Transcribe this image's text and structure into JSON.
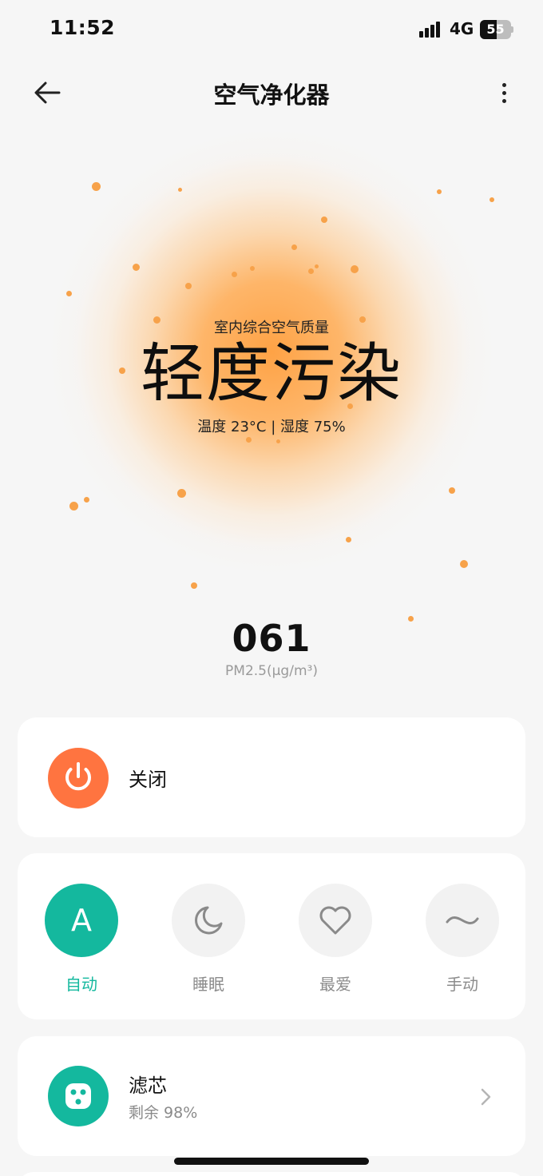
{
  "status_bar": {
    "time": "11:52",
    "network": "4G",
    "battery_level": "55",
    "battery_fraction": 0.55
  },
  "header": {
    "title": "空气净化器",
    "back_icon": "arrow-left-icon",
    "more_icon": "more-vertical-icon"
  },
  "air_quality": {
    "caption": "室内综合空气质量",
    "level": "轻度污染",
    "climate": "温度 23°C | 湿度 75%",
    "pm_value": "061",
    "pm_unit": "PM2.5(μg/m³)",
    "accent": "#f7a24a"
  },
  "power": {
    "label": "关闭",
    "icon": "power-icon",
    "color": "#ff7440"
  },
  "modes": [
    {
      "key": "auto",
      "label": "自动",
      "glyph": "A",
      "icon": "auto-letter-icon",
      "active": true
    },
    {
      "key": "sleep",
      "label": "睡眠",
      "icon": "moon-icon",
      "active": false
    },
    {
      "key": "favorite",
      "label": "最爱",
      "icon": "heart-icon",
      "active": false
    },
    {
      "key": "manual",
      "label": "手动",
      "icon": "wave-icon",
      "active": false
    }
  ],
  "filter": {
    "title": "滤芯",
    "remaining": "剩余 98%",
    "remaining_fraction": 0.98,
    "icon": "filter-icon",
    "color": "#14b89e"
  }
}
